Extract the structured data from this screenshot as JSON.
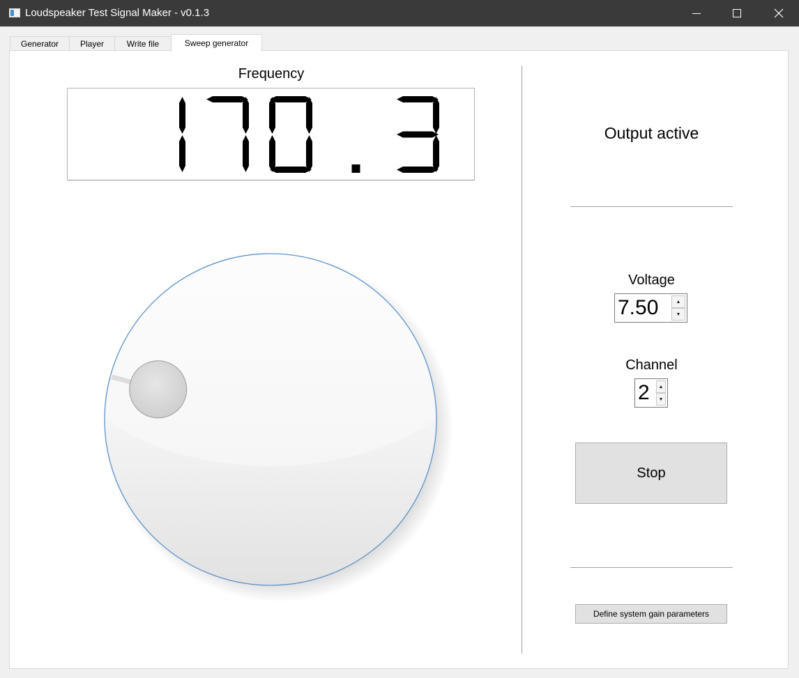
{
  "window": {
    "title": "Loudspeaker Test Signal Maker - v0.1.3",
    "controls": [
      "minimize-icon",
      "maximize-icon",
      "close-icon"
    ]
  },
  "tabs": [
    {
      "label": "Generator",
      "active": false
    },
    {
      "label": "Player",
      "active": false
    },
    {
      "label": "Write file",
      "active": false
    },
    {
      "label": "Sweep generator",
      "active": true
    }
  ],
  "frequency": {
    "label": "Frequency",
    "display": "170.3"
  },
  "knob": {
    "level": 0.2,
    "accent": "#6a9fd0"
  },
  "status": {
    "text": "Output active"
  },
  "voltage": {
    "label": "Voltage",
    "value": "7.50"
  },
  "channel": {
    "label": "Channel",
    "value": "2"
  },
  "buttons": {
    "stop": "Stop",
    "gain": "Define system gain parameters"
  },
  "icons": {
    "spin_up": "▲",
    "spin_down": "▼"
  }
}
